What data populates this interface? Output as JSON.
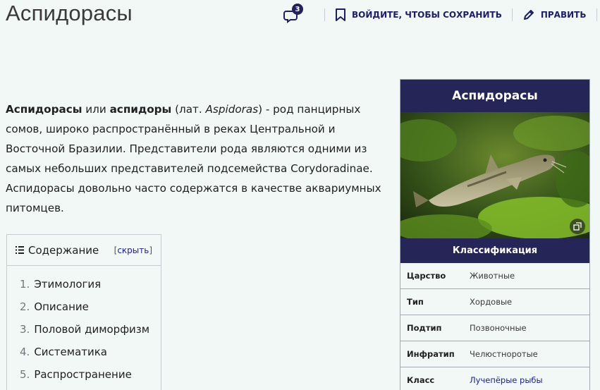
{
  "title": "Аспидорасы",
  "header": {
    "comments_count": "3",
    "save_label": "ВОЙДИТЕ, ЧТОБЫ СОХРАНИТЬ",
    "edit_label": "ПРАВИТЬ"
  },
  "intro": {
    "term1": "Аспидорасы",
    "or": " или ",
    "term2": "аспидоры",
    "lat_prefix": " (лат. ",
    "lat_name": "Aspidoras",
    "rest": ") - род панцирных сомов, широко распространённый в реках Центральной и Восточной Бразилии. Представители рода являются одними из самых небольших представителей подсемейства Corydoradinae. Аспидорасы довольно часто содержатся в качестве аквариумных питомцев."
  },
  "toc": {
    "title": "Содержание",
    "toggle_open": "[",
    "toggle_label": "скрыть",
    "toggle_close": "]",
    "items": [
      {
        "num": "1.",
        "label": "Этимология"
      },
      {
        "num": "2.",
        "label": "Описание"
      },
      {
        "num": "3.",
        "label": "Половой диморфизм"
      },
      {
        "num": "4.",
        "label": "Систематика"
      },
      {
        "num": "5.",
        "label": "Распространение"
      }
    ]
  },
  "infobox": {
    "title": "Аспидорасы",
    "subheader": "Классификация",
    "rows": [
      {
        "key": "Царство",
        "value": "Животные"
      },
      {
        "key": "Тип",
        "value": "Хордовые"
      },
      {
        "key": "Подтип",
        "value": "Позвоночные"
      },
      {
        "key": "Инфратип",
        "value": "Челюстноротые"
      },
      {
        "key": "Класс",
        "value": "Лучепёрые рыбы"
      }
    ]
  }
}
